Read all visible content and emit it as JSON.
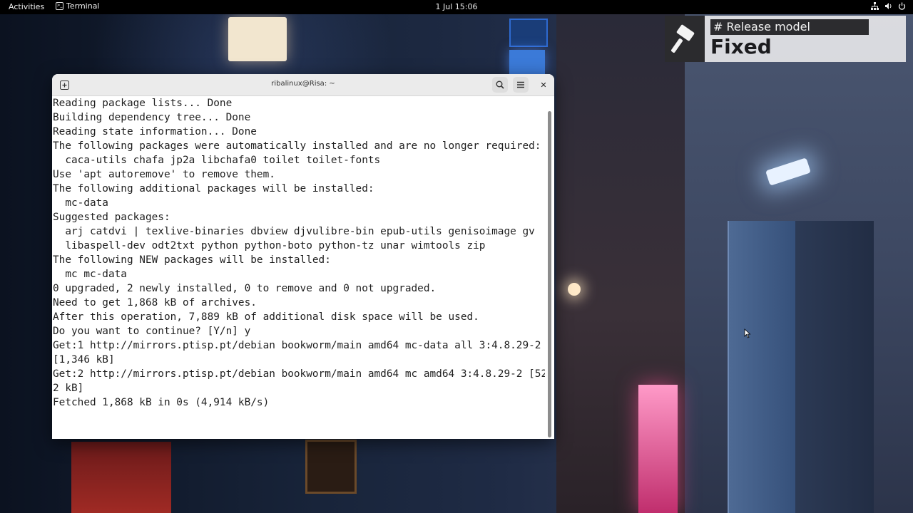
{
  "topbar": {
    "activities": "Activities",
    "app_name": "Terminal",
    "clock": "1 Jul  15:06",
    "tray": [
      "network-icon",
      "volume-icon",
      "power-icon"
    ]
  },
  "badge": {
    "label": "# Release model",
    "value": "Fixed"
  },
  "terminal": {
    "title": "ribalinux@Risa: ~",
    "lines": [
      "Reading package lists... Done",
      "Building dependency tree... Done",
      "Reading state information... Done",
      "The following packages were automatically installed and are no longer required:",
      "  caca-utils chafa jp2a libchafa0 toilet toilet-fonts",
      "Use 'apt autoremove' to remove them.",
      "The following additional packages will be installed:",
      "  mc-data",
      "Suggested packages:",
      "  arj catdvi | texlive-binaries dbview djvulibre-bin epub-utils genisoimage gv",
      "  libaspell-dev odt2txt python python-boto python-tz unar wimtools zip",
      "The following NEW packages will be installed:",
      "  mc mc-data",
      "0 upgraded, 2 newly installed, 0 to remove and 0 not upgraded.",
      "Need to get 1,868 kB of archives.",
      "After this operation, 7,889 kB of additional disk space will be used.",
      "Do you want to continue? [Y/n] y",
      "Get:1 http://mirrors.ptisp.pt/debian bookworm/main amd64 mc-data all 3:4.8.29-2",
      "[1,346 kB]",
      "Get:2 http://mirrors.ptisp.pt/debian bookworm/main amd64 mc amd64 3:4.8.29-2 [52",
      "2 kB]",
      "Fetched 1,868 kB in 0s (4,914 kB/s)"
    ]
  },
  "colors": {
    "topbar_bg": "#000000",
    "terminal_bg": "#ffffff",
    "header_bg": "#ebebeb",
    "badge_dark": "#2c2c2f"
  }
}
